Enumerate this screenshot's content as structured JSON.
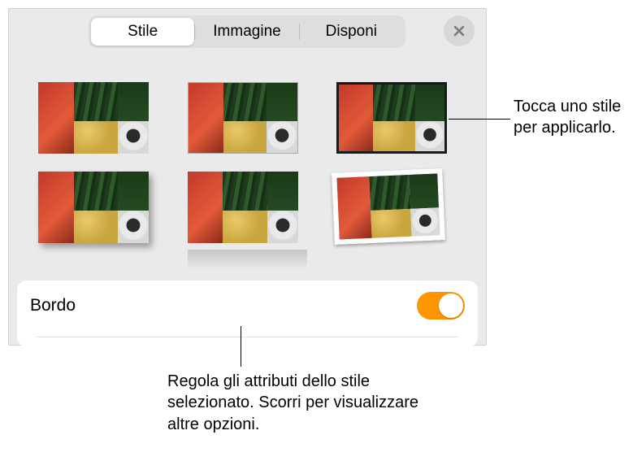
{
  "header": {
    "tabs": [
      {
        "label": "Stile",
        "active": true
      },
      {
        "label": "Immagine",
        "active": false
      },
      {
        "label": "Disponi",
        "active": false
      }
    ],
    "close_icon": "close-icon"
  },
  "styles": {
    "options": [
      {
        "name": "none"
      },
      {
        "name": "gray-border"
      },
      {
        "name": "black-border"
      },
      {
        "name": "shadow"
      },
      {
        "name": "reflection"
      },
      {
        "name": "frame"
      }
    ]
  },
  "border": {
    "label": "Bordo",
    "enabled": true
  },
  "callouts": {
    "style": "Tocca uno stile per applicarlo.",
    "attributes": "Regola gli attributi dello stile selezionato. Scorri per visualizzare altre opzioni."
  },
  "colors": {
    "accent": "#ff9500"
  }
}
